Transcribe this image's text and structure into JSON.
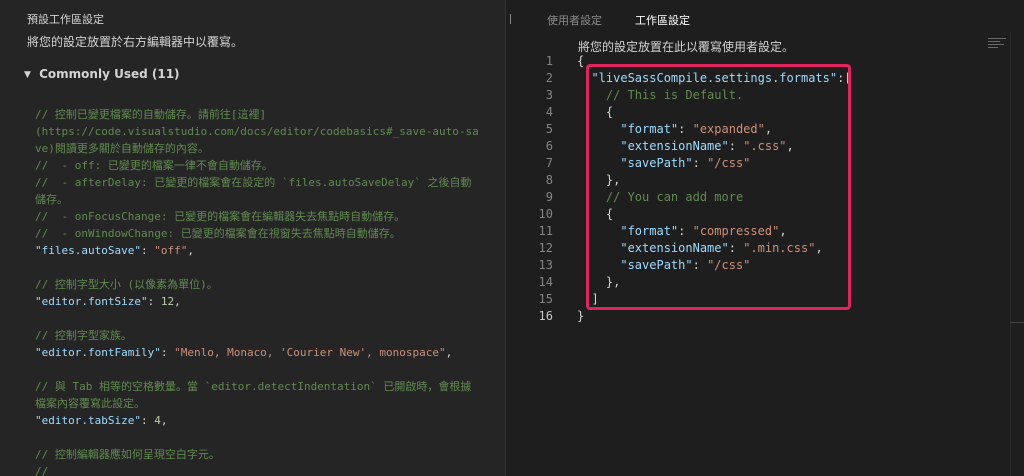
{
  "left_panel": {
    "title": "預設工作區設定",
    "description": "將您的設定放置於右方編輯器中以覆寫。",
    "group": {
      "label": "Commonly Used (11)",
      "arrow": "▼"
    },
    "lines": [
      [
        {
          "t": "c",
          "v": "// 控制已變更檔案的自動儲存。請前往[這裡]"
        }
      ],
      [
        {
          "t": "c",
          "v": "(https://code.visualstudio.com/docs/editor/codebasics#_save-auto-sa"
        }
      ],
      [
        {
          "t": "c",
          "v": "ve)閱讀更多關於自動儲存的內容。"
        }
      ],
      [
        {
          "t": "c",
          "v": "//  - off: 已變更的檔案一律不會自動儲存。"
        }
      ],
      [
        {
          "t": "c",
          "v": "//  - afterDelay: 已變更的檔案會在設定的 `files.autoSaveDelay` 之後自動"
        }
      ],
      [
        {
          "t": "c",
          "v": "儲存。"
        }
      ],
      [
        {
          "t": "c",
          "v": "//  - onFocusChange: 已變更的檔案會在編輯器失去焦點時自動儲存。"
        }
      ],
      [
        {
          "t": "c",
          "v": "//  - onWindowChange: 已變更的檔案會在視窗失去焦點時自動儲存。"
        }
      ],
      [
        {
          "t": "k",
          "v": "\"files.autoSave\""
        },
        {
          "t": "p",
          "v": ": "
        },
        {
          "t": "s",
          "v": "\"off\""
        },
        {
          "t": "p",
          "v": ","
        }
      ],
      [],
      [
        {
          "t": "c",
          "v": "// 控制字型大小 (以像素為單位)。"
        }
      ],
      [
        {
          "t": "k",
          "v": "\"editor.fontSize\""
        },
        {
          "t": "p",
          "v": ": "
        },
        {
          "t": "n",
          "v": "12"
        },
        {
          "t": "p",
          "v": ","
        }
      ],
      [],
      [
        {
          "t": "c",
          "v": "// 控制字型家族。"
        }
      ],
      [
        {
          "t": "k",
          "v": "\"editor.fontFamily\""
        },
        {
          "t": "p",
          "v": ": "
        },
        {
          "t": "s",
          "v": "\"Menlo, Monaco, 'Courier New', monospace\""
        },
        {
          "t": "p",
          "v": ","
        }
      ],
      [],
      [
        {
          "t": "c",
          "v": "// 與 Tab 相等的空格數量。當 `editor.detectIndentation` 已開啟時，會根據"
        }
      ],
      [
        {
          "t": "c",
          "v": "檔案內容覆寫此設定。"
        }
      ],
      [
        {
          "t": "k",
          "v": "\"editor.tabSize\""
        },
        {
          "t": "p",
          "v": ": "
        },
        {
          "t": "n",
          "v": "4"
        },
        {
          "t": "p",
          "v": ","
        }
      ],
      [],
      [
        {
          "t": "c",
          "v": "// 控制編輯器應如何呈現空白字元。"
        }
      ],
      [
        {
          "t": "c",
          "v": "//"
        }
      ]
    ]
  },
  "right_panel": {
    "tabs": {
      "user": "使用者設定",
      "workspace": "工作區設定"
    },
    "description": "將您的設定放置在此以覆寫使用者設定。",
    "active_line": 16,
    "lines": [
      {
        "n": "1",
        "parts": [
          {
            "t": "p",
            "v": "{"
          }
        ]
      },
      {
        "n": "2",
        "parts": [
          {
            "t": "p",
            "v": "  "
          },
          {
            "t": "k",
            "v": "\"liveSassCompile.settings.formats\""
          },
          {
            "t": "p",
            "v": ":["
          }
        ]
      },
      {
        "n": "3",
        "parts": [
          {
            "t": "p",
            "v": "    "
          },
          {
            "t": "c",
            "v": "// This is Default."
          }
        ]
      },
      {
        "n": "4",
        "parts": [
          {
            "t": "p",
            "v": "    {"
          }
        ]
      },
      {
        "n": "5",
        "parts": [
          {
            "t": "p",
            "v": "      "
          },
          {
            "t": "k",
            "v": "\"format\""
          },
          {
            "t": "p",
            "v": ": "
          },
          {
            "t": "s",
            "v": "\"expanded\""
          },
          {
            "t": "p",
            "v": ","
          }
        ]
      },
      {
        "n": "6",
        "parts": [
          {
            "t": "p",
            "v": "      "
          },
          {
            "t": "k",
            "v": "\"extensionName\""
          },
          {
            "t": "p",
            "v": ": "
          },
          {
            "t": "s",
            "v": "\".css\""
          },
          {
            "t": "p",
            "v": ","
          }
        ]
      },
      {
        "n": "7",
        "parts": [
          {
            "t": "p",
            "v": "      "
          },
          {
            "t": "k",
            "v": "\"savePath\""
          },
          {
            "t": "p",
            "v": ": "
          },
          {
            "t": "s",
            "v": "\"/css\""
          }
        ]
      },
      {
        "n": "8",
        "parts": [
          {
            "t": "p",
            "v": "    },"
          }
        ]
      },
      {
        "n": "9",
        "parts": [
          {
            "t": "p",
            "v": "    "
          },
          {
            "t": "c",
            "v": "// You can add more"
          }
        ]
      },
      {
        "n": "10",
        "parts": [
          {
            "t": "p",
            "v": "    {"
          }
        ]
      },
      {
        "n": "11",
        "parts": [
          {
            "t": "p",
            "v": "      "
          },
          {
            "t": "k",
            "v": "\"format\""
          },
          {
            "t": "p",
            "v": ": "
          },
          {
            "t": "s",
            "v": "\"compressed\""
          },
          {
            "t": "p",
            "v": ","
          }
        ]
      },
      {
        "n": "12",
        "parts": [
          {
            "t": "p",
            "v": "      "
          },
          {
            "t": "k",
            "v": "\"extensionName\""
          },
          {
            "t": "p",
            "v": ": "
          },
          {
            "t": "s",
            "v": "\".min.css\""
          },
          {
            "t": "p",
            "v": ","
          }
        ]
      },
      {
        "n": "13",
        "parts": [
          {
            "t": "p",
            "v": "      "
          },
          {
            "t": "k",
            "v": "\"savePath\""
          },
          {
            "t": "p",
            "v": ": "
          },
          {
            "t": "s",
            "v": "\"/css\""
          }
        ]
      },
      {
        "n": "14",
        "parts": [
          {
            "t": "p",
            "v": "    },"
          }
        ]
      },
      {
        "n": "15",
        "parts": [
          {
            "t": "p",
            "v": "  ]"
          }
        ]
      },
      {
        "n": "16",
        "parts": [
          {
            "t": "p",
            "v": "}"
          }
        ]
      }
    ]
  },
  "colors": {
    "comment": "#608b4e",
    "key": "#9cdcfe",
    "string": "#ce9178",
    "number": "#b5cea8",
    "highlight_box": "#e0245e"
  }
}
